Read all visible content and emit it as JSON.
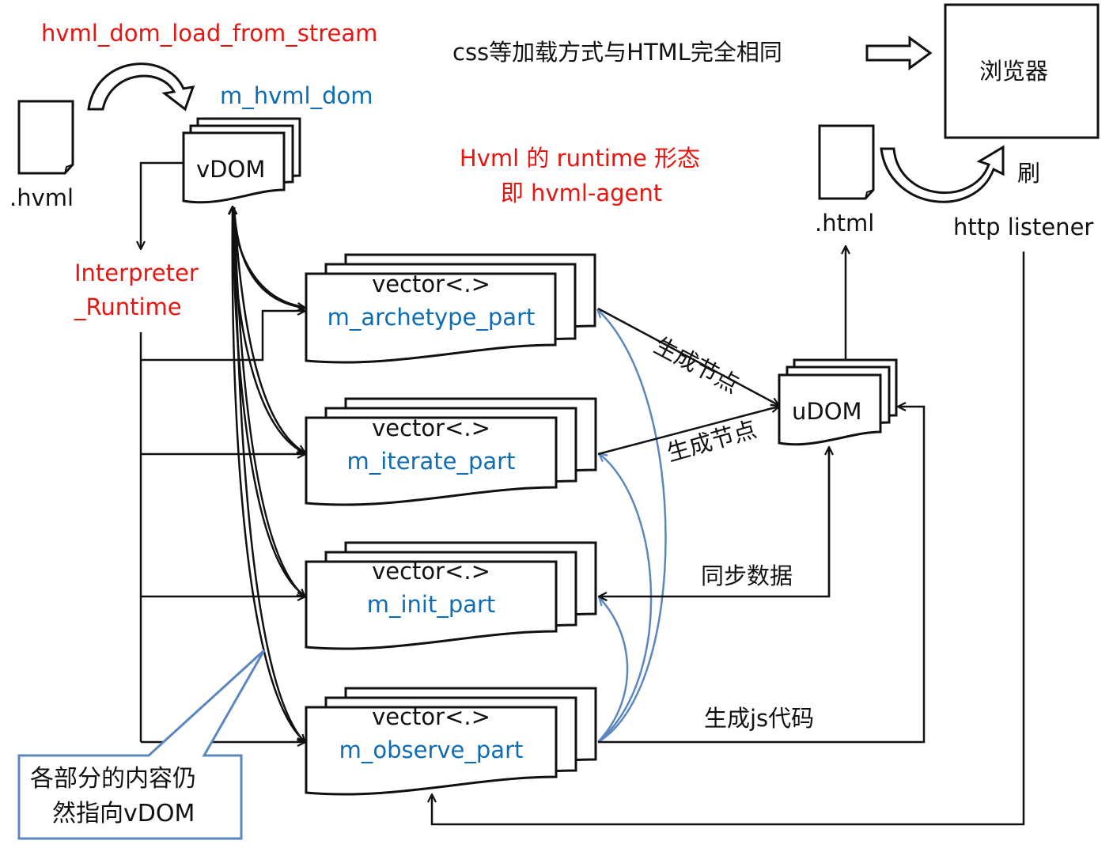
{
  "labels": {
    "load_from_stream": "hvml_dom_load_from_stream",
    "m_hvml_dom": "m_hvml_dom",
    "vdom": "vDOM",
    "hvml_file": ".hvml",
    "interpreter_line1": "Interpreter",
    "interpreter_line2": "_Runtime",
    "css_note": "css等加载方式与HTML完全相同",
    "browser": "浏览器",
    "refresh": "刷",
    "http_listener": "http listener",
    "html_file": ".html",
    "runtime_line1": "Hvml 的 runtime 形态",
    "runtime_line2": "即 hvml-agent",
    "udom": "uDOM",
    "gen_node_1": "生成节点",
    "gen_node_2": "生成节点",
    "sync_data": "同步数据",
    "gen_js": "生成js代码",
    "callout_line1": "各部分的内容仍",
    "callout_line2": "然指向vDOM"
  },
  "parts": [
    {
      "type_label": "vector<.>",
      "name": "m_archetype_part"
    },
    {
      "type_label": "vector<.>",
      "name": "m_iterate_part"
    },
    {
      "type_label": "vector<.>",
      "name": "m_init_part"
    },
    {
      "type_label": "vector<.>",
      "name": "m_observe_part"
    }
  ],
  "colors": {
    "red": "#e8140f",
    "blue": "#0e6cb5",
    "curve_blue": "#5b86c0",
    "black": "#111111"
  }
}
